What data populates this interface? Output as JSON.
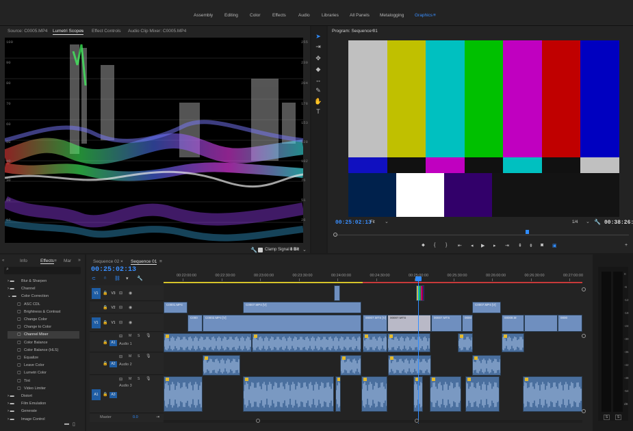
{
  "workspaces": [
    {
      "label": "Assembly"
    },
    {
      "label": "Editing"
    },
    {
      "label": "Color"
    },
    {
      "label": "Effects"
    },
    {
      "label": "Audio"
    },
    {
      "label": "Libraries"
    },
    {
      "label": "All Panels"
    },
    {
      "label": "Metalogging"
    },
    {
      "label": "Graphics"
    }
  ],
  "source_panel": {
    "tabs": [
      {
        "label": "Source: C0005.MP4"
      },
      {
        "label": "Lumetri Scopes"
      },
      {
        "label": "Effect Controls"
      },
      {
        "label": "Audio Clip Mixer: C0005.MP4"
      }
    ],
    "clamp_label": "Clamp Signal",
    "bit_depth": "8 Bit",
    "scale_left": [
      "100",
      "90",
      "80",
      "70",
      "60",
      "50",
      "40",
      "30",
      "20",
      "10"
    ],
    "scale_right": [
      "255",
      "230",
      "204",
      "178",
      "153",
      "128",
      "102",
      "76",
      "51",
      "26"
    ]
  },
  "program": {
    "title": "Program: Sequence 01",
    "timecode_in": "00:25:02:13",
    "fit": "Fit",
    "quality": "1/4",
    "timecode_out": "00:38:26:14"
  },
  "effects_panel": {
    "tabs": [
      {
        "label": "Info"
      },
      {
        "label": "Effects"
      },
      {
        "label": "Mar"
      }
    ],
    "items": [
      {
        "label": "Blur & Sharpen",
        "type": "folder"
      },
      {
        "label": "Channel",
        "type": "folder"
      },
      {
        "label": "Color Correction",
        "type": "folder-open"
      },
      {
        "label": "ASC CDL",
        "type": "effect"
      },
      {
        "label": "Brightness & Contrast",
        "type": "effect"
      },
      {
        "label": "Change Color",
        "type": "effect"
      },
      {
        "label": "Change to Color",
        "type": "effect"
      },
      {
        "label": "Channel Mixer",
        "type": "effect",
        "selected": true
      },
      {
        "label": "Color Balance",
        "type": "effect"
      },
      {
        "label": "Color Balance (HLS)",
        "type": "effect"
      },
      {
        "label": "Equalize",
        "type": "effect"
      },
      {
        "label": "Leave Color",
        "type": "effect"
      },
      {
        "label": "Lumetri Color",
        "type": "effect"
      },
      {
        "label": "Tint",
        "type": "effect"
      },
      {
        "label": "Video Limiter",
        "type": "effect"
      },
      {
        "label": "Distort",
        "type": "folder"
      },
      {
        "label": "Film Emulation",
        "type": "folder"
      },
      {
        "label": "Generate",
        "type": "folder"
      },
      {
        "label": "Image Control",
        "type": "folder"
      }
    ]
  },
  "timeline": {
    "tabs": [
      {
        "label": "Sequence 02"
      },
      {
        "label": "Sequence 01"
      }
    ],
    "timecode": "00:25:02:13",
    "ruler": [
      "00:22:00:00",
      "00:22:30:00",
      "00:23:00:00",
      "00:23:30:00",
      "00:24:00:00",
      "00:24:30:00",
      "00:25:00:00",
      "00:25:30:00",
      "00:26:00:00",
      "00:26:30:00",
      "00:27:00:00"
    ],
    "tracks": [
      {
        "id": "V3",
        "target": "V1"
      },
      {
        "id": "V2"
      },
      {
        "id": "V1",
        "target": "V1"
      },
      {
        "id": "A1",
        "name": "Audio 1"
      },
      {
        "id": "A2",
        "name": "Audio 2"
      },
      {
        "id": "A3",
        "name": "Audio 3",
        "target": "A1"
      }
    ],
    "track_flags": {
      "m": "M",
      "s": "S"
    },
    "master": {
      "label": "Master",
      "value": "0.0"
    },
    "video_clips": [
      {
        "label": "C0001.MP4"
      },
      {
        "label": "C0007.MP4 [V]"
      },
      {
        "label": "C0007.MP4 [V]"
      },
      {
        "label": "C000"
      },
      {
        "label": "C0002.MP4 [V]"
      },
      {
        "label": "00007.MTS [V]"
      },
      {
        "label": "00007.MTS"
      },
      {
        "label": "00007.MTS"
      },
      {
        "label": "0000"
      },
      {
        "label": "00008.M"
      },
      {
        "label": "0000"
      }
    ]
  },
  "meter": {
    "scale": [
      "0",
      "-6",
      "-12",
      "-18",
      "-24",
      "-30",
      "-36",
      "-42",
      "-48",
      "-54",
      "dB"
    ],
    "solo": [
      "S",
      "S"
    ]
  },
  "colors": {
    "accent": "#2f8cff",
    "bars_top": [
      "#c0c0c0",
      "#c0c000",
      "#00c0c0",
      "#00c000",
      "#c000c0",
      "#c00000",
      "#0000c0"
    ],
    "bars_mid": [
      "#1010c0",
      "#111111",
      "#c000c0",
      "#111111",
      "#00c0c0",
      "#111111",
      "#c0c0c0"
    ],
    "bars_bottom": [
      "#00214c",
      "#ffffff",
      "#32006a",
      "#131313",
      "#131313",
      "#131313"
    ]
  }
}
